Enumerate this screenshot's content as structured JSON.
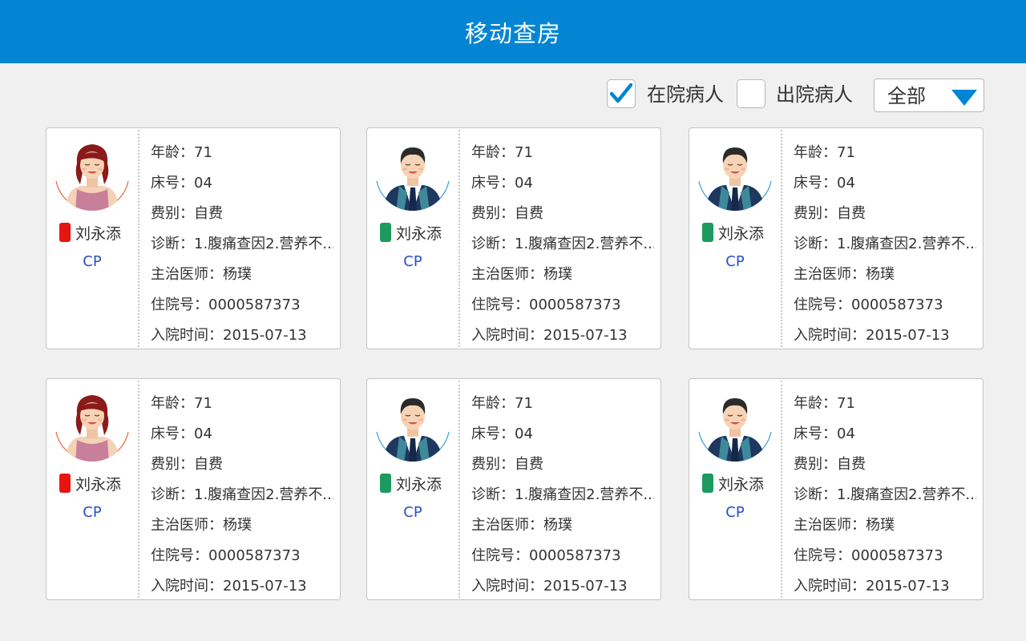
{
  "header": {
    "title": "移动查房"
  },
  "filters": {
    "in_hospital": {
      "label": "在院病人",
      "checked": true
    },
    "discharged": {
      "label": "出院病人",
      "checked": false
    },
    "select": {
      "value": "全部"
    }
  },
  "colors": {
    "primary": "#0385d3",
    "tag_red": "#e8140f",
    "tag_green": "#1d9a5e",
    "cp": "#2a4fc7"
  },
  "patients": [
    {
      "name": "刘永添",
      "gender": "female",
      "tag_color": "#e8140f",
      "cp": "CP",
      "rows": [
        "年龄：71",
        "床号：04",
        "费别：自费",
        "诊断：1.腹痛查因2.营养不...",
        "主治医师：杨璞",
        "住院号：0000587373",
        "入院时间：2015-07-13"
      ]
    },
    {
      "name": "刘永添",
      "gender": "male",
      "tag_color": "#1d9a5e",
      "cp": "CP",
      "rows": [
        "年龄：71",
        "床号：04",
        "费别：自费",
        "诊断：1.腹痛查因2.营养不...",
        "主治医师：杨璞",
        "住院号：0000587373",
        "入院时间：2015-07-13"
      ]
    },
    {
      "name": "刘永添",
      "gender": "male",
      "tag_color": "#1d9a5e",
      "cp": "CP",
      "rows": [
        "年龄：71",
        "床号：04",
        "费别：自费",
        "诊断：1.腹痛查因2.营养不...",
        "主治医师：杨璞",
        "住院号：0000587373",
        "入院时间：2015-07-13"
      ]
    },
    {
      "name": "刘永添",
      "gender": "female",
      "tag_color": "#e8140f",
      "cp": "CP",
      "rows": [
        "年龄：71",
        "床号：04",
        "费别：自费",
        "诊断：1.腹痛查因2.营养不...",
        "主治医师：杨璞",
        "住院号：0000587373",
        "入院时间：2015-07-13"
      ]
    },
    {
      "name": "刘永添",
      "gender": "male",
      "tag_color": "#1d9a5e",
      "cp": "CP",
      "rows": [
        "年龄：71",
        "床号：04",
        "费别：自费",
        "诊断：1.腹痛查因2.营养不...",
        "主治医师：杨璞",
        "住院号：0000587373",
        "入院时间：2015-07-13"
      ]
    },
    {
      "name": "刘永添",
      "gender": "male",
      "tag_color": "#1d9a5e",
      "cp": "CP",
      "rows": [
        "年龄：71",
        "床号：04",
        "费别：自费",
        "诊断：1.腹痛查因2.营养不...",
        "主治医师：杨璞",
        "住院号：0000587373",
        "入院时间：2015-07-13"
      ]
    }
  ]
}
